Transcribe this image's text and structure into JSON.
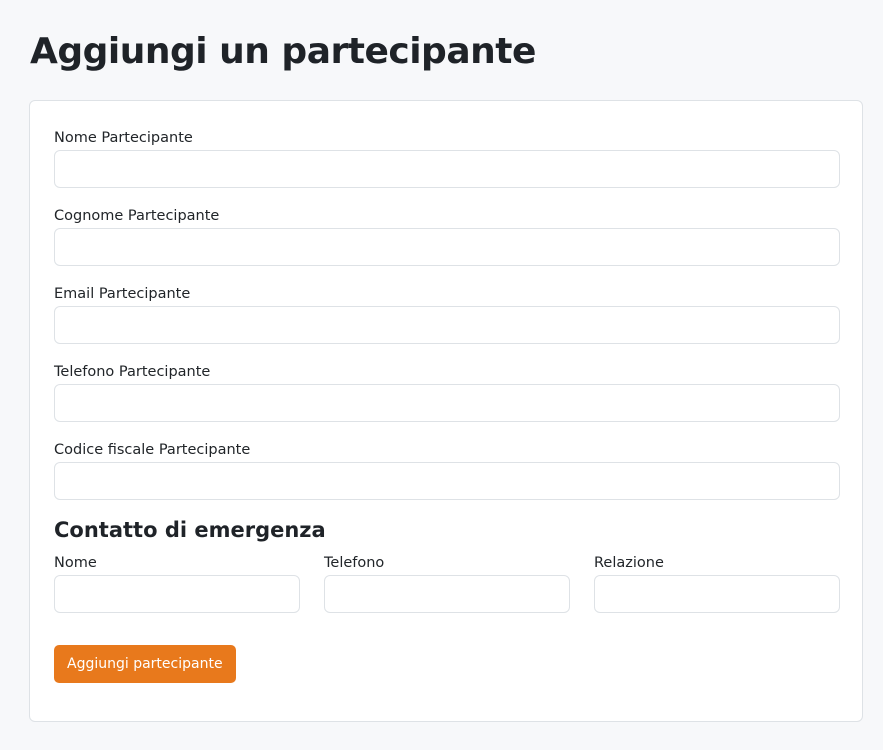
{
  "page": {
    "title": "Aggiungi un partecipante"
  },
  "form": {
    "fields": [
      {
        "label": "Nome Partecipante",
        "value": "",
        "placeholder": ""
      },
      {
        "label": "Cognome Partecipante",
        "value": "",
        "placeholder": ""
      },
      {
        "label": "Email Partecipante",
        "value": "",
        "placeholder": ""
      },
      {
        "label": "Telefono Partecipante",
        "value": "",
        "placeholder": ""
      },
      {
        "label": "Codice fiscale Partecipante",
        "value": "",
        "placeholder": ""
      }
    ],
    "emergency": {
      "title": "Contatto di emergenza",
      "fields": [
        {
          "label": "Nome",
          "value": "",
          "placeholder": ""
        },
        {
          "label": "Telefono",
          "value": "",
          "placeholder": ""
        },
        {
          "label": "Relazione",
          "value": "",
          "placeholder": ""
        }
      ]
    },
    "submit_label": "Aggiungi partecipante"
  },
  "colors": {
    "accent": "#e8791c",
    "background": "#f7f8fa",
    "card": "#ffffff",
    "border": "#dee2e6"
  }
}
